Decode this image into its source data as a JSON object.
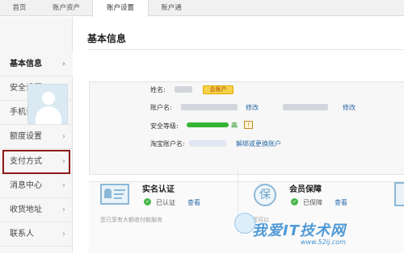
{
  "topnav": {
    "tabs": [
      {
        "label": "首页"
      },
      {
        "label": "账户资产"
      },
      {
        "label": "账户设置"
      },
      {
        "label": "账户通"
      }
    ]
  },
  "sidebar": {
    "items": [
      {
        "label": "基本信息"
      },
      {
        "label": "安全设置"
      },
      {
        "label": "手机设置"
      },
      {
        "label": "额度设置"
      },
      {
        "label": "支付方式"
      },
      {
        "label": "消息中心"
      },
      {
        "label": "收货地址"
      },
      {
        "label": "联系人"
      }
    ],
    "chevron": "›"
  },
  "main": {
    "title": "基本信息",
    "profile": {
      "name_label": "姓名:",
      "vip_badge": "会账户",
      "account_label": "账户名:",
      "edit1": "修改",
      "edit2": "修改",
      "security_label": "安全等级:",
      "security_level": "高",
      "security_level_fraction": 1.0,
      "taobao_label": "淘宝账户名:",
      "unbind_link": "解绑或更换账户"
    },
    "cards": [
      {
        "title": "实名认证",
        "status": "已认证",
        "action": "查看",
        "hint": "您已享有大额收付款服务"
      },
      {
        "title": "会员保障",
        "status": "已保障",
        "action": "查看",
        "hint": "您可以"
      }
    ],
    "shield_glyph": "保"
  },
  "watermark": {
    "text": "我爱IT技术网",
    "url": "www.52ij.com"
  },
  "colors": {
    "highlight_border": "#8b1a1a",
    "link": "#2a6aa8",
    "security_bar": "#34b334",
    "watermark": "#3f90d4"
  }
}
